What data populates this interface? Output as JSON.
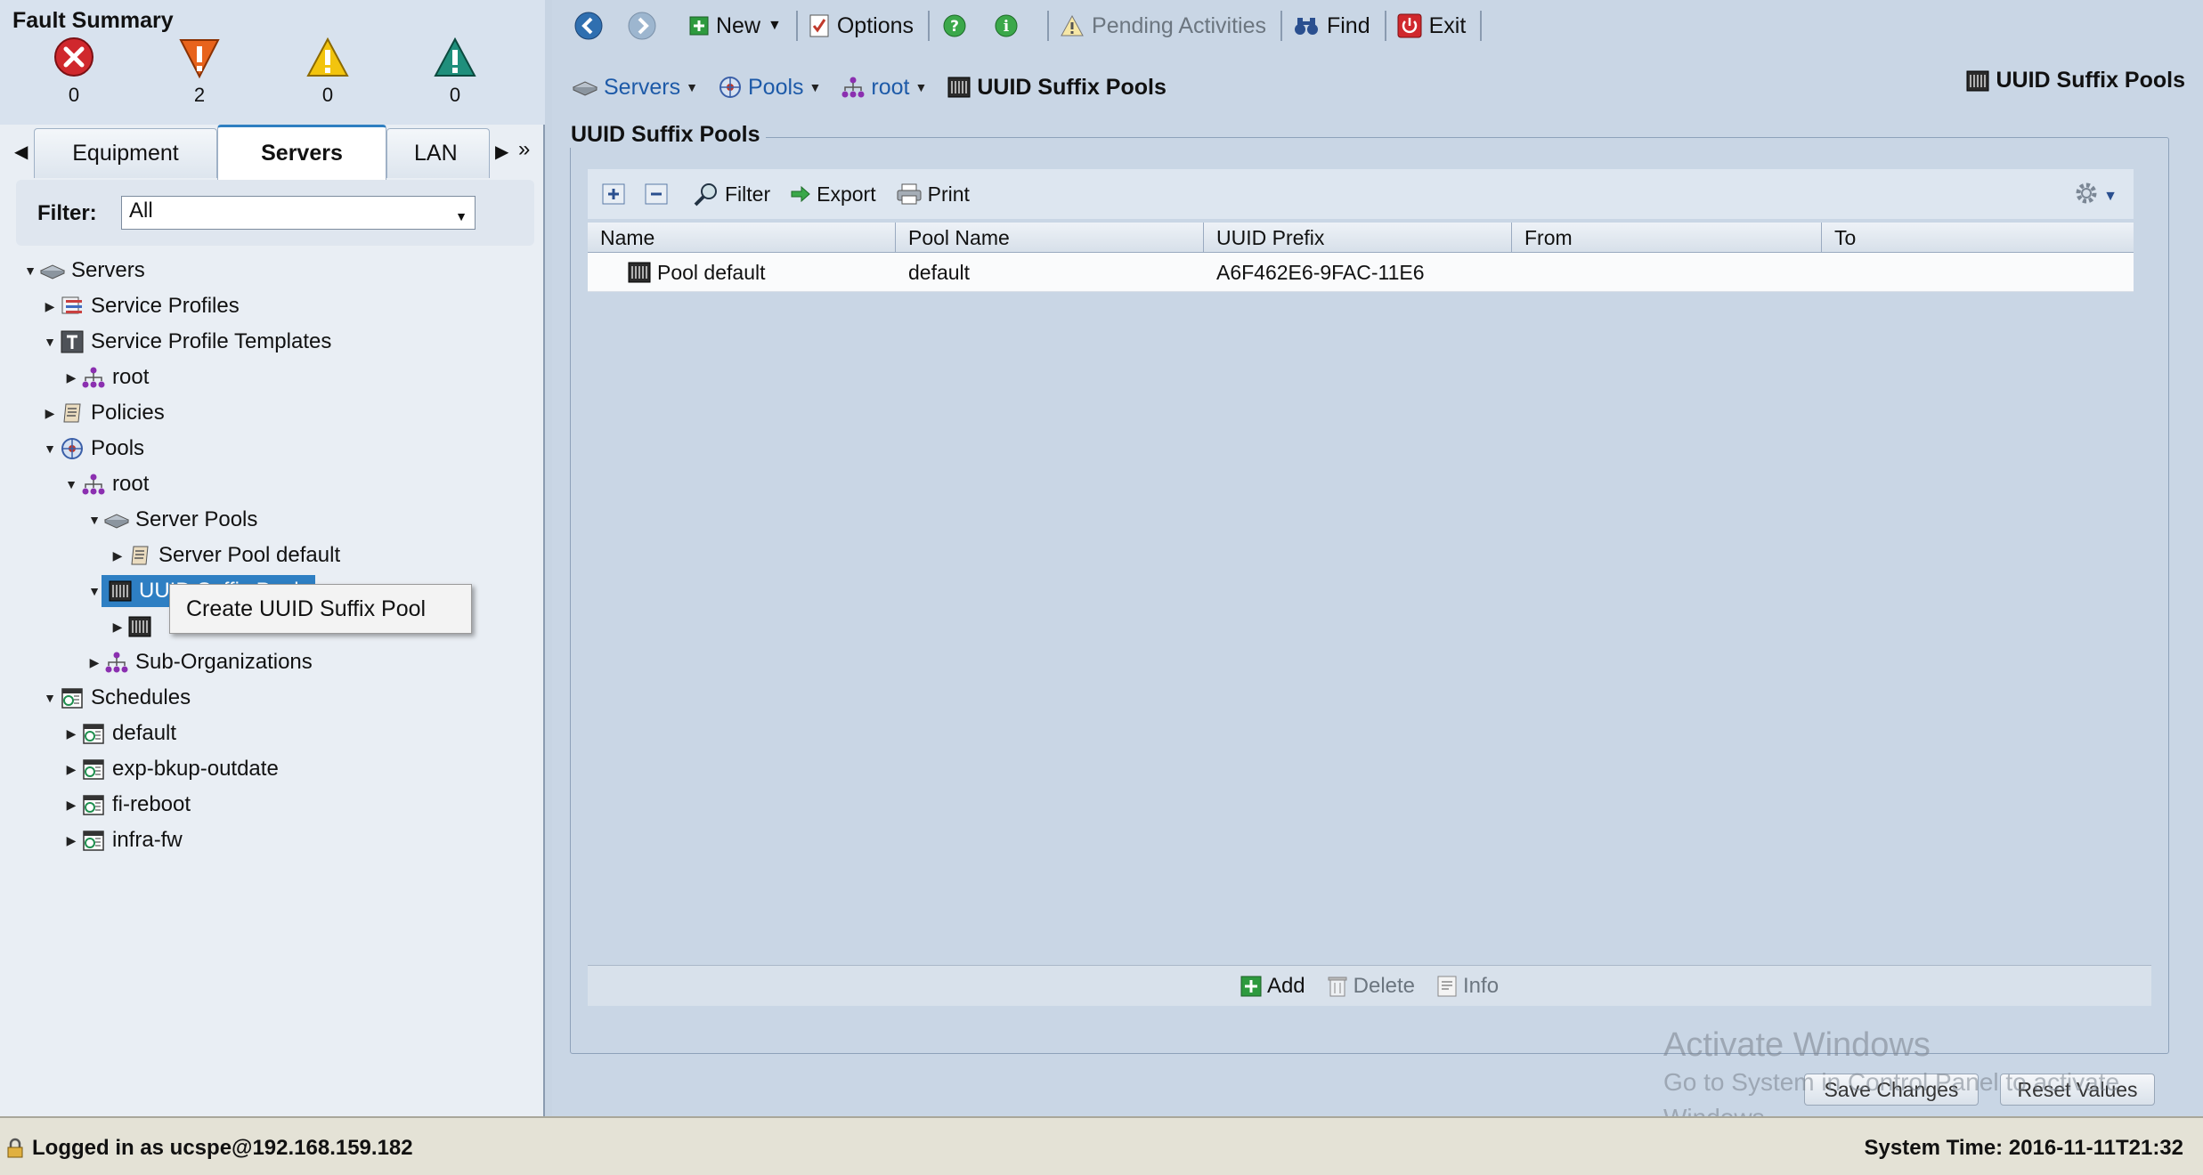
{
  "fault_summary": {
    "title": "Fault Summary",
    "items": [
      {
        "icon": "critical-fault-icon",
        "count": "0",
        "color": "#d0282d"
      },
      {
        "icon": "major-fault-icon",
        "count": "2",
        "color": "#e8631c"
      },
      {
        "icon": "minor-fault-icon",
        "count": "0",
        "color": "#f2c40e"
      },
      {
        "icon": "warning-fault-icon",
        "count": "0",
        "color": "#1f8f7c"
      }
    ]
  },
  "nav_tabs": [
    {
      "label": "Equipment",
      "active": false
    },
    {
      "label": "Servers",
      "active": true
    },
    {
      "label": "LAN",
      "active": false
    }
  ],
  "filter": {
    "label": "Filter:",
    "value": "All"
  },
  "tree": {
    "servers": "Servers",
    "service_profiles": "Service Profiles",
    "service_profile_templates": "Service Profile Templates",
    "root_1": "root",
    "policies": "Policies",
    "pools": "Pools",
    "root_2": "root",
    "server_pools": "Server Pools",
    "server_pool_default": "Server Pool default",
    "uuid_suffix_pools": "UUID Suffix Pools",
    "sub_orgs": "Sub-Organizations",
    "schedules": "Schedules",
    "sched_default": "default",
    "sched_exp": "exp-bkup-outdate",
    "sched_fi": "fi-reboot",
    "sched_infra": "infra-fw"
  },
  "context_menu": {
    "item": "Create UUID Suffix Pool"
  },
  "toolbar": {
    "new_label": "New",
    "options_label": "Options",
    "pending_label": "Pending Activities",
    "find_label": "Find",
    "exit_label": "Exit"
  },
  "breadcrumb": {
    "servers": "Servers",
    "pools": "Pools",
    "root": "root",
    "current": "UUID Suffix Pools"
  },
  "header_right": "UUID Suffix Pools",
  "panel_title": "UUID Suffix Pools",
  "grid_tools": {
    "filter": "Filter",
    "export": "Export",
    "print": "Print"
  },
  "grid": {
    "columns": [
      "Name",
      "Pool Name",
      "UUID Prefix",
      "From",
      "To"
    ],
    "rows": [
      {
        "name": "Pool default",
        "pool_name": "default",
        "uuid_prefix": "A6F462E6-9FAC-11E6",
        "from": "",
        "to": ""
      }
    ]
  },
  "footer_actions": {
    "add": "Add",
    "delete": "Delete",
    "info": "Info"
  },
  "buttons": {
    "save": "Save Changes",
    "reset": "Reset Values"
  },
  "watermark": {
    "line1": "Activate Windows",
    "line2": "Go to System in Control Panel to activate",
    "line3": "Windows."
  },
  "status": {
    "login": "Logged in as ucspe@192.168.159.182",
    "time": "System Time: 2016-11-11T21:32"
  }
}
